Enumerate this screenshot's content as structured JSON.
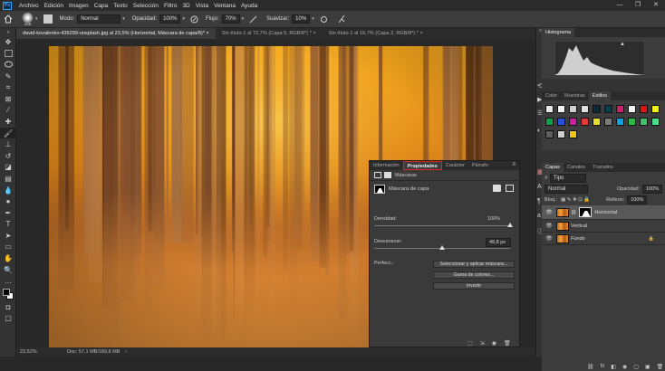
{
  "menu": {
    "logo": "Ps",
    "items": [
      "Archivo",
      "Edición",
      "Imagen",
      "Capa",
      "Texto",
      "Selección",
      "Filtro",
      "3D",
      "Vista",
      "Ventana",
      "Ayuda"
    ],
    "win_min": "—",
    "win_max": "❐",
    "win_close": "✕"
  },
  "options": {
    "brush_size": "125",
    "mode_label": "Modo:",
    "mode_value": "Normal",
    "opacity_label": "Opacidad:",
    "opacity_value": "100%",
    "flow_label": "Flujo:",
    "flow_value": "70%",
    "smooth_label": "Suavizar:",
    "smooth_value": "10%"
  },
  "tabs": [
    {
      "label": "david-kovalenko-436299-unsplash.jpg al 23,5% (Horizontal, Máscara de capa/8)* ×"
    },
    {
      "label": "Sin título-1 al 72,7% (Capa 5, RGB/8*) * ×"
    },
    {
      "label": "Sin título-1 al 16,7% (Capa 2, RGB/8*) * ×"
    }
  ],
  "status": {
    "zoom": "23,52%",
    "doc": "Doc: 57,1 MB/189,8 MB",
    "arrow": "›"
  },
  "histogram": {
    "title": "Histograma",
    "warning": "▲"
  },
  "color_tabs": [
    "Color",
    "Muestras",
    "Estilos"
  ],
  "style_colors": [
    "#e8e8e8",
    "#f2f2f2",
    "#d0d0d0",
    "#e0e0e0",
    "#0a2a3a",
    "#0d3c4a",
    "#cc1f6e",
    "#f4f4f4",
    "#e11414",
    "#eef21a",
    "#0aa14a",
    "#2a4fd8",
    "#cc1fa0",
    "#e03a3a",
    "#e9e02b",
    "#7a7a7a",
    "#0da0e2",
    "#2fb84a",
    "#3fc06a",
    "#4ae08a",
    "#5f5f5f",
    "#cfcfcf",
    "#f0c814"
  ],
  "layers_panel": {
    "tabs": [
      "Capas",
      "Canales",
      "Trazados"
    ],
    "filter": "Tipo",
    "blend": "Normal",
    "opacity_label": "Opacidad:",
    "opacity_value": "100%",
    "lock_label": "Bloq.:",
    "fill_label": "Relleno:",
    "fill_value": "100%",
    "layers": [
      {
        "name": "Horizontal"
      },
      {
        "name": "Vertical"
      },
      {
        "name": "Fondo",
        "lock": "🔒"
      }
    ],
    "footer": [
      "⛓",
      "fx",
      "◧",
      "◉",
      "▢",
      "▣",
      "🗑"
    ]
  },
  "properties": {
    "tabs": [
      "Información",
      "Propiedades",
      "Carácter",
      "Párrafo"
    ],
    "menu_icon": "≡",
    "masks_label": "Máscaras",
    "mask_label": "Máscara de capa",
    "density_label": "Densidad:",
    "density_value": "100%",
    "density": 1.0,
    "feather_label": "Desvanecer:",
    "feather_value": "49,8 px",
    "feather": 0.5,
    "refine_label": "Perfecc.:",
    "btn_select_mask": "Seleccionar y aplicar máscara...",
    "btn_color_range": "Gama de colores...",
    "btn_invert": "Invertir",
    "footer": [
      "⬚",
      "⇲",
      "◉",
      "🗑"
    ]
  }
}
